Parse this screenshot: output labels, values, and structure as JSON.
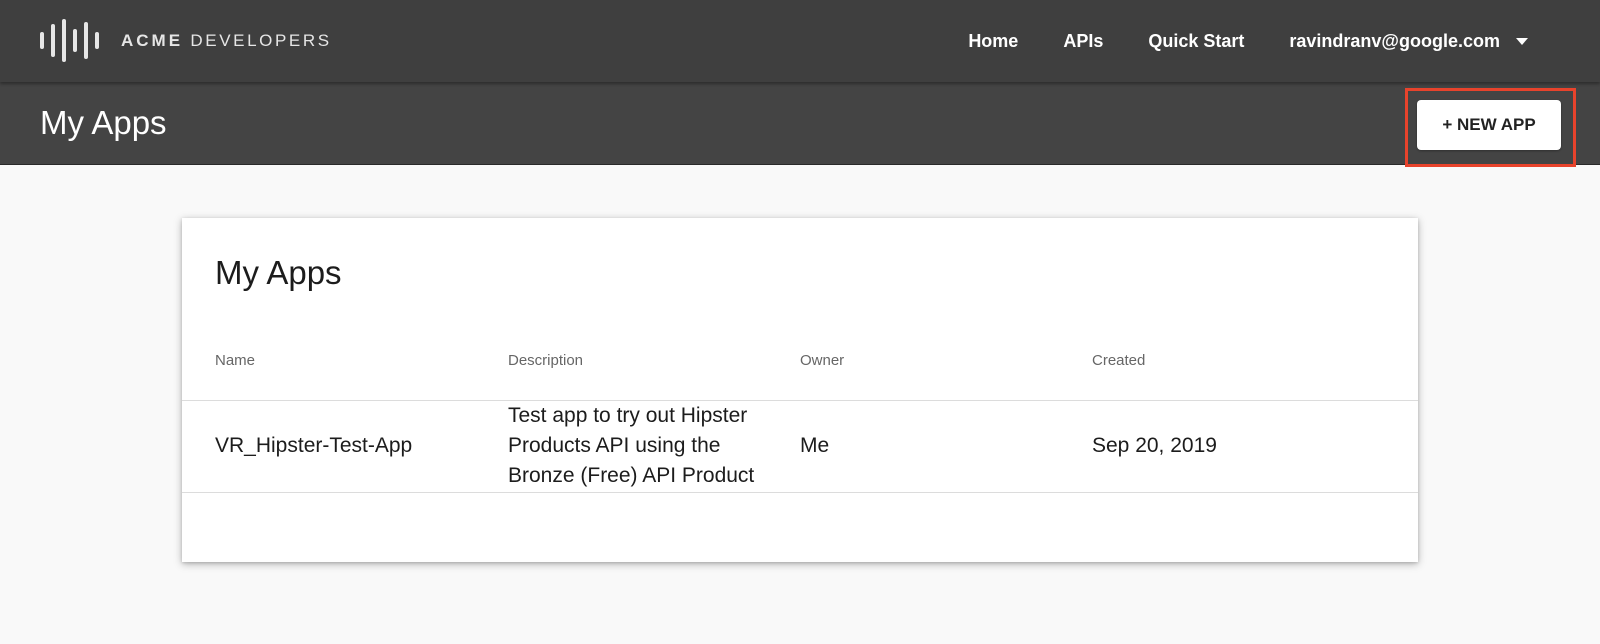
{
  "header": {
    "logo_acme": "ACME",
    "logo_developers": "DEVELOPERS",
    "nav": {
      "home": "Home",
      "apis": "APIs",
      "quick_start": "Quick Start"
    },
    "user_email": "ravindranv@google.com"
  },
  "subheader": {
    "title": "My Apps",
    "new_app_label": "+ NEW APP",
    "highlight_color": "#e8432c"
  },
  "card": {
    "title": "My Apps",
    "columns": {
      "name": "Name",
      "description": "Description",
      "owner": "Owner",
      "created": "Created"
    },
    "rows": [
      {
        "name": "VR_Hipster-Test-App",
        "description": "Test app to try out Hipster Products API using the Bronze (Free) API Product",
        "owner": "Me",
        "created": "Sep 20, 2019"
      }
    ]
  },
  "colors": {
    "topbar": "#3f3f3f",
    "subheader": "#444444",
    "page_bg": "#f9f9f9"
  }
}
